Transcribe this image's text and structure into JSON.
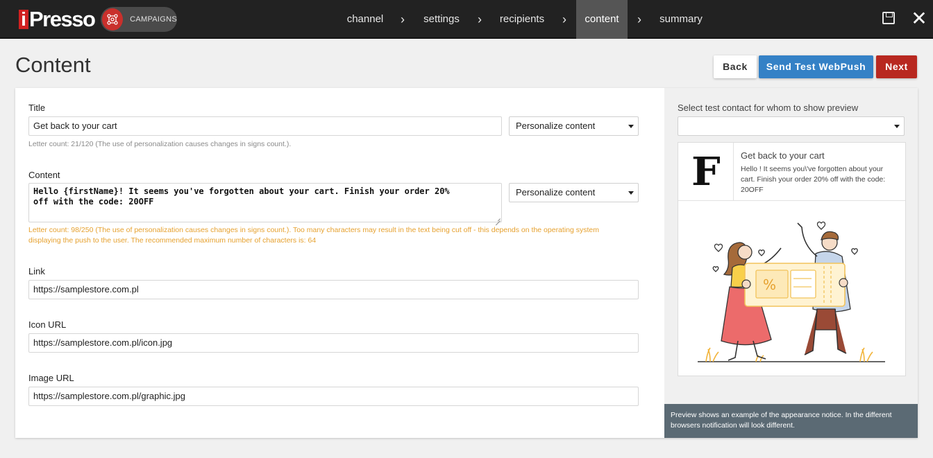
{
  "app": {
    "logo_text": "Presso",
    "logo_i": "i",
    "module_label": "CAMPAIGNS"
  },
  "nav": {
    "steps": [
      {
        "label": "channel",
        "active": false
      },
      {
        "label": "settings",
        "active": false
      },
      {
        "label": "recipients",
        "active": false
      },
      {
        "label": "content",
        "active": true
      },
      {
        "label": "summary",
        "active": false
      }
    ],
    "separator": "›",
    "close_glyph": "✕"
  },
  "header": {
    "title": "Content",
    "back_label": "Back",
    "test_label": "Send Test WebPush",
    "next_label": "Next"
  },
  "form": {
    "title_label": "Title",
    "title_value": "Get back to your cart",
    "title_personalize": "Personalize content",
    "title_hint": "Letter count: 21/120 (The use of personalization causes changes in signs count.).",
    "content_label": "Content",
    "content_line1": "Hello {firstName}! It seems you've forgotten about your cart. Finish your order 20%",
    "content_line2": "off with the code: 20OFF",
    "content_personalize": "Personalize content",
    "content_hint_line1": "Letter count: 98/250 (The use of personalization causes changes in signs count.). Too many characters may result in the text being cut off - this depends on the operating system",
    "content_hint_line2": "displaying the push to the user. The recommended maximum number of characters is: 64",
    "link_label": "Link",
    "link_value": "https://samplestore.com.pl",
    "icon_label": "Icon URL",
    "icon_value": "https://samplestore.com.pl/icon.jpg",
    "image_label": "Image URL",
    "image_value": "https://samplestore.com.pl/graphic.jpg"
  },
  "preview": {
    "select_label": "Select test contact for whom to show preview",
    "selected_contact": "",
    "icon_letter": "F",
    "notif_title": "Get back to your cart",
    "notif_body": "Hello ! It seems you\\'ve forgotten about your cart. Finish your order 20% off with the code: 20OFF",
    "footer": "Preview shows an example of the appearance notice. In the different browsers notification will look different."
  },
  "colors": {
    "topbar": "#222222",
    "nav_active": "#555555",
    "primary": "#3481c6",
    "danger": "#b82820",
    "warning_text": "#e6a12f",
    "preview_footer": "#5b6a74"
  }
}
